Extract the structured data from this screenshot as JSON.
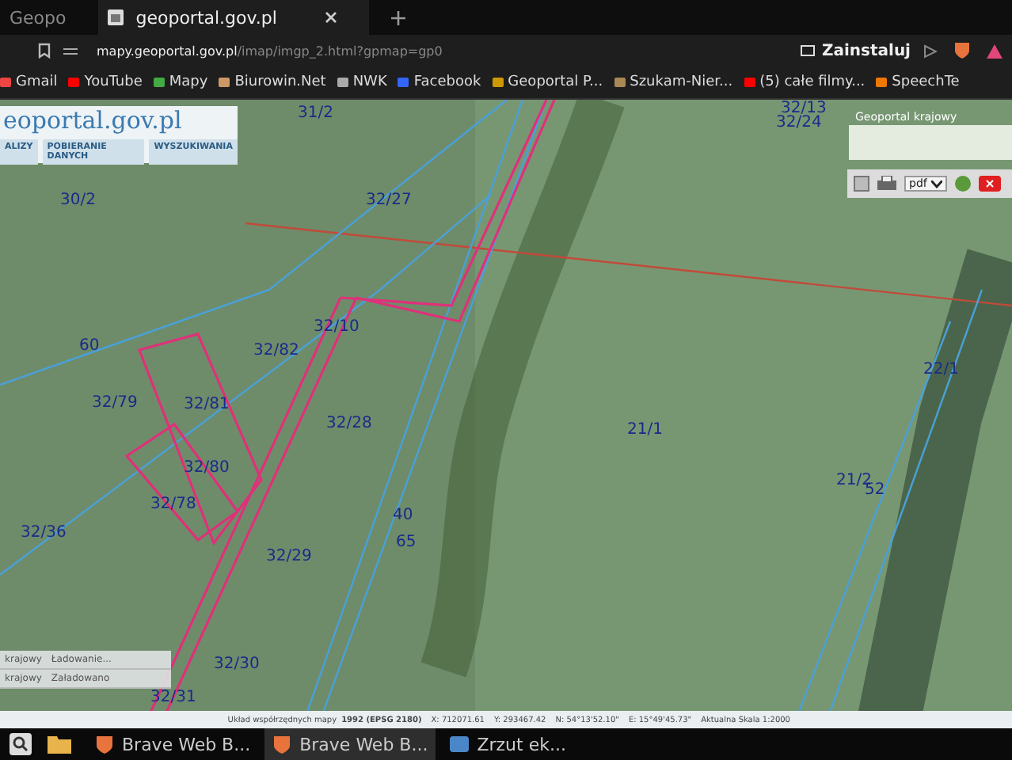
{
  "browser": {
    "tabs": [
      {
        "label": "Geopo",
        "selected": false
      },
      {
        "label": "geoportal.gov.pl",
        "selected": true
      }
    ],
    "address": {
      "host": "mapy.geoportal.gov.pl",
      "path": "/imap/imgp_2.html?gpmap=gp0"
    },
    "install_label": "Zainstaluj",
    "bookmarks": [
      "Gmail",
      "YouTube",
      "Mapy",
      "Biurowin.Net",
      "NWK",
      "Facebook",
      "Geoportal P...",
      "Szukam-Nier...",
      "(5) całe filmy...",
      "SpeechTe"
    ]
  },
  "map": {
    "logo": "eoportal.gov.pl",
    "menu": [
      "ALIZY",
      "POBIERANIE DANYCH",
      "WYSZUKIWANIA"
    ],
    "overview_title": "Geoportal krajowy",
    "format": "pdf",
    "parcels": [
      "31/2",
      "32/13",
      "32/24",
      "30/2",
      "32/27",
      "32/10",
      "60",
      "32/82",
      "22/1",
      "32/79",
      "32/81",
      "32/28",
      "21/1",
      "32/80",
      "21/2",
      "52",
      "32/78",
      "40",
      "65",
      "32/36",
      "32/29",
      "32/30",
      "32/31"
    ],
    "layers": [
      {
        "name": "krajowy",
        "status": "Ładowanie..."
      },
      {
        "name": "krajowy",
        "status": "Załadowano"
      }
    ],
    "status_bar": [
      "Układ współrzędnych mapy",
      "1992 (EPSG 2180)",
      "X: 712071.61",
      "Y: 293467.42",
      "N: 54°13'52.10\"",
      "E: 15°49'45.73\"",
      "Aktualna Skala 1:2000"
    ]
  },
  "taskbar": [
    {
      "label": "Brave Web B...",
      "selected": false
    },
    {
      "label": "Brave Web B...",
      "selected": true
    },
    {
      "label": "Zrzut ek...",
      "selected": false
    }
  ]
}
